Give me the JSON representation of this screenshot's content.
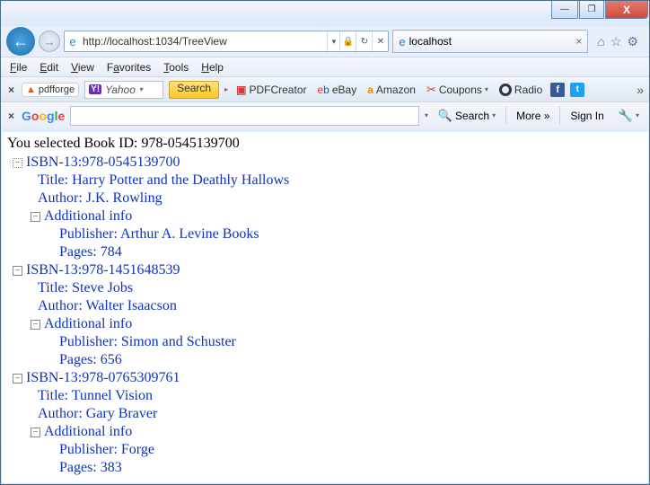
{
  "window": {
    "min_label": "—",
    "max_label": "❐",
    "close_label": "X"
  },
  "nav": {
    "back": "←",
    "forward": "→",
    "url": "http://localhost:1034/TreeView",
    "dropdown": "▾",
    "refresh": "↻",
    "stop": "✕",
    "lock": "🔒"
  },
  "tab": {
    "title": "localhost",
    "close": "×"
  },
  "chrome_icons": {
    "home": "⌂",
    "fav": "☆",
    "gear": "⚙"
  },
  "menu": {
    "file": "File",
    "edit": "Edit",
    "view": "View",
    "favorites": "Favorites",
    "tools": "Tools",
    "help": "Help"
  },
  "toolbar": {
    "close": "×",
    "pdfforge": "pdfforge",
    "yahoo_y": "Y!",
    "yahoo_text": "Yahoo",
    "search": "Search",
    "pdfcreator": "PDFCreator",
    "ebay": "eBay",
    "amazon": "Amazon",
    "coupons": "Coupons",
    "radio": "Radio",
    "fb": "f",
    "tw": "t",
    "more": "»",
    "go_arrow": "▸",
    "dd": "▾"
  },
  "toolbar2": {
    "close": "×",
    "g1": "G",
    "g2": "o",
    "g3": "o",
    "g4": "g",
    "g5": "l",
    "g6": "e",
    "search": "Search",
    "more": "More »",
    "signin": "Sign In",
    "dd": "▾",
    "input_value": ""
  },
  "page": {
    "selected_line": "You selected Book ID: 978-0545139700",
    "books": [
      {
        "isbn_label": "ISBN-13:978-0545139700",
        "title": "Title: Harry Potter and the Deathly Hallows",
        "author": "Author: J.K. Rowling",
        "additional_label": "Additional info",
        "publisher": "Publisher: Arthur A. Levine Books",
        "pages": "Pages: 784",
        "first": true
      },
      {
        "isbn_label": "ISBN-13:978-1451648539",
        "title": "Title: Steve Jobs",
        "author": "Author: Walter Isaacson",
        "additional_label": "Additional info",
        "publisher": "Publisher: Simon and Schuster",
        "pages": "Pages: 656",
        "first": false
      },
      {
        "isbn_label": "ISBN-13:978-0765309761",
        "title": "Title: Tunnel Vision",
        "author": "Author: Gary Braver",
        "additional_label": "Additional info",
        "publisher": "Publisher: Forge",
        "pages": "Pages: 383",
        "first": false
      }
    ],
    "expander_minus": "−"
  }
}
